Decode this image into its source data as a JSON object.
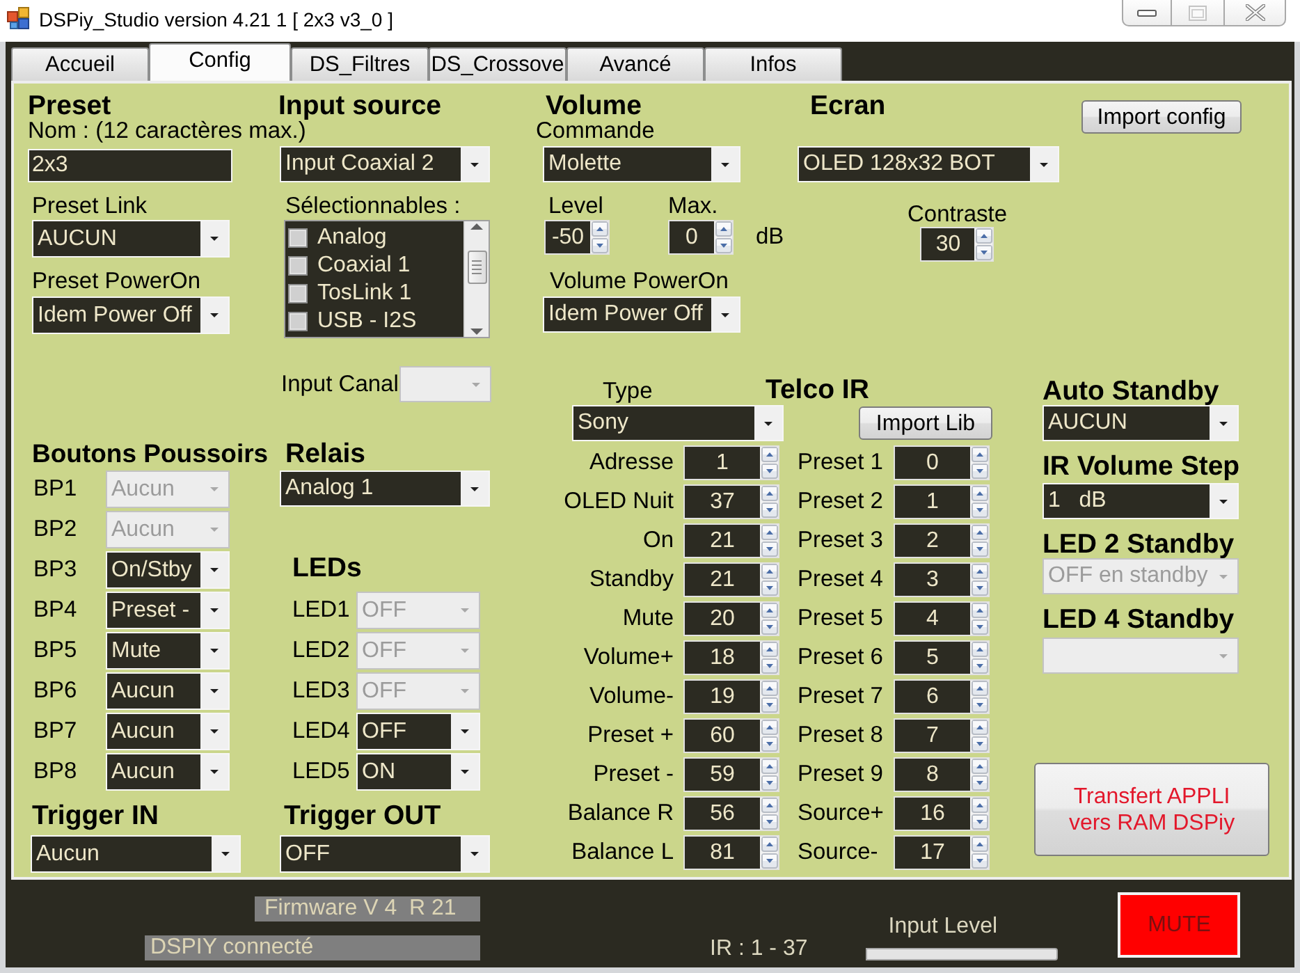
{
  "window": {
    "title": "DSPiy_Studio version 4.21 1 [ 2x3 v3_0 ]"
  },
  "tabs": [
    {
      "label": "Accueil",
      "selected": false
    },
    {
      "label": "Config",
      "selected": true
    },
    {
      "label": "DS_Filtres",
      "selected": false
    },
    {
      "label": "DS_Crossove",
      "selected": false
    },
    {
      "label": "Avancé",
      "selected": false
    },
    {
      "label": "Infos",
      "selected": false
    }
  ],
  "preset": {
    "heading": "Preset",
    "name": {
      "label": "Nom : (12 caractères max.)",
      "value": "2x3"
    },
    "link": {
      "label": "Preset Link",
      "value": "AUCUN"
    },
    "power_on": {
      "label": "Preset PowerOn",
      "value": "Idem Power Off"
    }
  },
  "input_source": {
    "heading": "Input source",
    "value": "Input Coaxial 2",
    "selectable_label": "Sélectionnables :",
    "selectable": [
      {
        "label": "Analog",
        "checked": false
      },
      {
        "label": "Coaxial 1",
        "checked": false
      },
      {
        "label": "TosLink 1",
        "checked": false
      },
      {
        "label": "USB - I2S",
        "checked": false
      }
    ],
    "canal": {
      "label": "Input Canal",
      "disabled": true
    }
  },
  "volume": {
    "heading": "Volume",
    "command": {
      "label": "Commande",
      "value": "Molette"
    },
    "level": {
      "label": "Level",
      "value": "-50"
    },
    "max": {
      "label": "Max.",
      "value": "0"
    },
    "unit": "dB",
    "power_on": {
      "label": "Volume PowerOn",
      "value": "Idem Power Off"
    }
  },
  "screen": {
    "heading": "Ecran",
    "value": "OLED 128x32 BOT",
    "contrast": {
      "label": "Contraste",
      "value": "30"
    }
  },
  "import_config_button": "Import config",
  "push_buttons": {
    "heading": "Boutons Poussoirs",
    "items": [
      {
        "label": "BP1",
        "value": "Aucun",
        "disabled": true
      },
      {
        "label": "BP2",
        "value": "Aucun",
        "disabled": true
      },
      {
        "label": "BP3",
        "value": "On/Stby",
        "disabled": false
      },
      {
        "label": "BP4",
        "value": "Preset -",
        "disabled": false
      },
      {
        "label": "BP5",
        "value": "Mute",
        "disabled": false
      },
      {
        "label": "BP6",
        "value": "Aucun",
        "disabled": false
      },
      {
        "label": "BP7",
        "value": "Aucun",
        "disabled": false
      },
      {
        "label": "BP8",
        "value": "Aucun",
        "disabled": false
      }
    ]
  },
  "relay": {
    "heading": "Relais",
    "value": "Analog 1"
  },
  "leds": {
    "heading": "LEDs",
    "items": [
      {
        "label": "LED1",
        "value": "OFF",
        "disabled": true
      },
      {
        "label": "LED2",
        "value": "OFF",
        "disabled": true
      },
      {
        "label": "LED3",
        "value": "OFF",
        "disabled": true
      },
      {
        "label": "LED4",
        "value": "OFF",
        "disabled": false
      },
      {
        "label": "LED5",
        "value": "ON",
        "disabled": false
      }
    ]
  },
  "trigger_in": {
    "heading": "Trigger IN",
    "value": "Aucun"
  },
  "trigger_out": {
    "heading": "Trigger OUT",
    "value": "OFF"
  },
  "ir_remote": {
    "type_label": "Type",
    "type_value": "Sony",
    "heading": "Telco IR",
    "import_button": "Import Lib",
    "codes": [
      {
        "label": "Adresse",
        "value": "1"
      },
      {
        "label": "OLED Nuit",
        "value": "37"
      },
      {
        "label": "On",
        "value": "21"
      },
      {
        "label": "Standby",
        "value": "21"
      },
      {
        "label": "Mute",
        "value": "20"
      },
      {
        "label": "Volume+",
        "value": "18"
      },
      {
        "label": "Volume-",
        "value": "19"
      },
      {
        "label": "Preset +",
        "value": "60"
      },
      {
        "label": "Preset -",
        "value": "59"
      },
      {
        "label": "Balance R",
        "value": "56"
      },
      {
        "label": "Balance L",
        "value": "81"
      }
    ],
    "preset_codes": [
      {
        "label": "Preset 1",
        "value": "0"
      },
      {
        "label": "Preset 2",
        "value": "1"
      },
      {
        "label": "Preset 3",
        "value": "2"
      },
      {
        "label": "Preset 4",
        "value": "3"
      },
      {
        "label": "Preset 5",
        "value": "4"
      },
      {
        "label": "Preset 6",
        "value": "5"
      },
      {
        "label": "Preset 7",
        "value": "6"
      },
      {
        "label": "Preset 8",
        "value": "7"
      },
      {
        "label": "Preset 9",
        "value": "8"
      },
      {
        "label": "Source+",
        "value": "16"
      },
      {
        "label": "Source-",
        "value": "17"
      }
    ]
  },
  "standby": [
    {
      "heading": "Auto Standby",
      "value": "AUCUN",
      "disabled": false
    },
    {
      "heading": "IR Volume Step",
      "value": "1   dB",
      "disabled": false
    },
    {
      "heading": "LED 2 Standby",
      "value": "OFF en standby",
      "disabled": true
    },
    {
      "heading": "LED 4 Standby",
      "disabled": true
    }
  ],
  "transfer_button": "Transfert APPLI vers RAM DSPiy",
  "status_bar": {
    "firmware": "Firmware V 4  R 21",
    "connection": "DSPIY connecté",
    "ir_range": "IR : 1 - 37",
    "input_level": {
      "label": "Input Level",
      "level": 0
    },
    "mute": {
      "label": "MUTE",
      "active": true
    }
  }
}
